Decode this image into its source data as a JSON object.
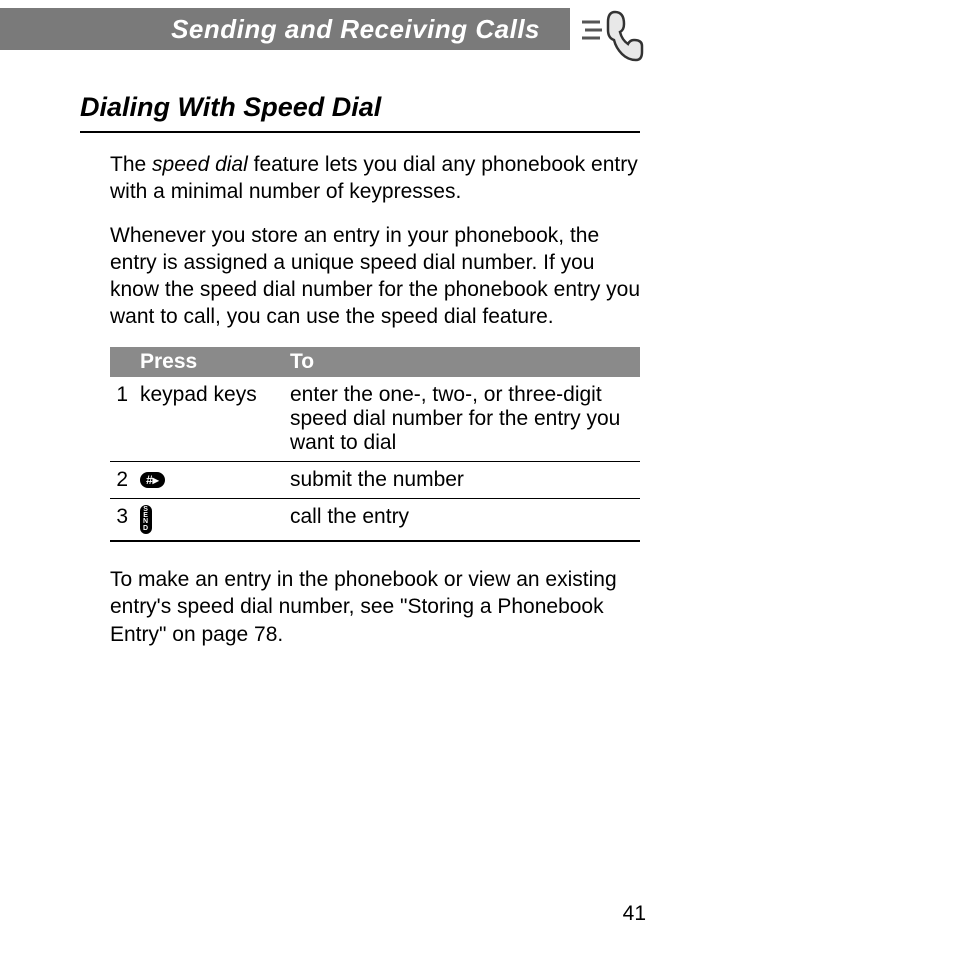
{
  "header": {
    "title": "Sending and Receiving Calls"
  },
  "section": {
    "title": "Dialing With Speed Dial",
    "intro_part1": "The ",
    "intro_italic": "speed dial",
    "intro_part2": " feature lets you dial any phonebook entry with a minimal number of keypresses.",
    "para2": "Whenever you store an entry in your phonebook, the entry is assigned a unique speed dial number. If you know the speed dial number for the phonebook entry you want to call, you can use the speed dial feature.",
    "outro": "To make an entry in the phonebook or view an existing entry's speed dial number, see \"Storing a Phonebook Entry\" on page 78."
  },
  "table": {
    "headers": {
      "press": "Press",
      "to": "To"
    },
    "rows": [
      {
        "num": "1",
        "press": "keypad keys",
        "to": "enter the one-, two-, or three-digit speed dial number for the entry you want to dial"
      },
      {
        "num": "2",
        "press_icon": "hash-key",
        "press_symbol": "#▸",
        "to": "submit the number"
      },
      {
        "num": "3",
        "press_icon": "send-key",
        "press_symbol": "S\nE\nN\nD",
        "to": "call the entry"
      }
    ]
  },
  "page_number": "41"
}
